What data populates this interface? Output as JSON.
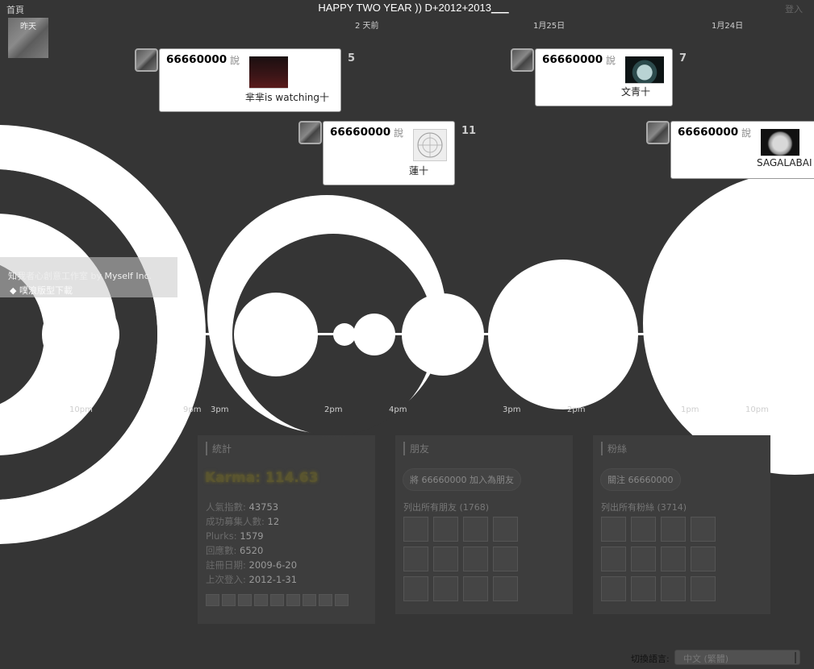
{
  "header": {
    "home": "首頁",
    "title": "HAPPY TWO YEAR )) D+2012+2013",
    "title_tail": "___",
    "login": "登入"
  },
  "timeline": {
    "yesterday": "昨天",
    "day_labels": [
      "2 天前",
      "1月25日",
      "1月24日"
    ],
    "time_labels": [
      "10pm",
      "9pm",
      "3pm",
      "2pm",
      "4pm",
      "3pm",
      "2pm",
      "1pm",
      "10pm"
    ]
  },
  "plurks": [
    {
      "user": "66660000",
      "says": "說",
      "caption": "芈芈is watching十",
      "count": "5",
      "thumb": "dark-red-photo"
    },
    {
      "user": "66660000",
      "says": "說",
      "caption": "文青十",
      "count": "7",
      "thumb": "teal-circle-photo"
    },
    {
      "user": "66660000",
      "says": "說",
      "caption": "蓮十",
      "count": "11",
      "thumb": "compass-sketch"
    },
    {
      "user": "66660000",
      "says": "說",
      "caption": "SAGALABAI",
      "count": "",
      "thumb": "moon-photo"
    }
  ],
  "overlay": {
    "line1": "知我者心創意工作室 by Myself Inc.",
    "line2": "◆ 噗浪版型下載"
  },
  "stats_panel": {
    "heading": "統計",
    "karma": "Karma: 114.63",
    "rows": [
      {
        "k": "人氣指數: ",
        "v": "43753"
      },
      {
        "k": "成功募集人數: ",
        "v": "12"
      },
      {
        "k": "Plurks: ",
        "v": "1579"
      },
      {
        "k": "回應數: ",
        "v": "6520"
      },
      {
        "k": "註冊日期: ",
        "v": "2009-6-20"
      },
      {
        "k": "上次登入: ",
        "v": "2012-1-31"
      }
    ]
  },
  "friends_panel": {
    "heading": "朋友",
    "button": "將 66660000 加入為朋友",
    "list_label": "列出所有朋友 (1768)"
  },
  "fans_panel": {
    "heading": "粉絲",
    "button": "關注 66660000",
    "list_label": "列出所有粉絲 (3714)"
  },
  "footer": {
    "lang_label": "切換語言:",
    "lang_value": "中文 (繁體)"
  },
  "colors": {
    "background": "#353535",
    "shape": "#ffffff",
    "panel": "#3d3d3d"
  }
}
